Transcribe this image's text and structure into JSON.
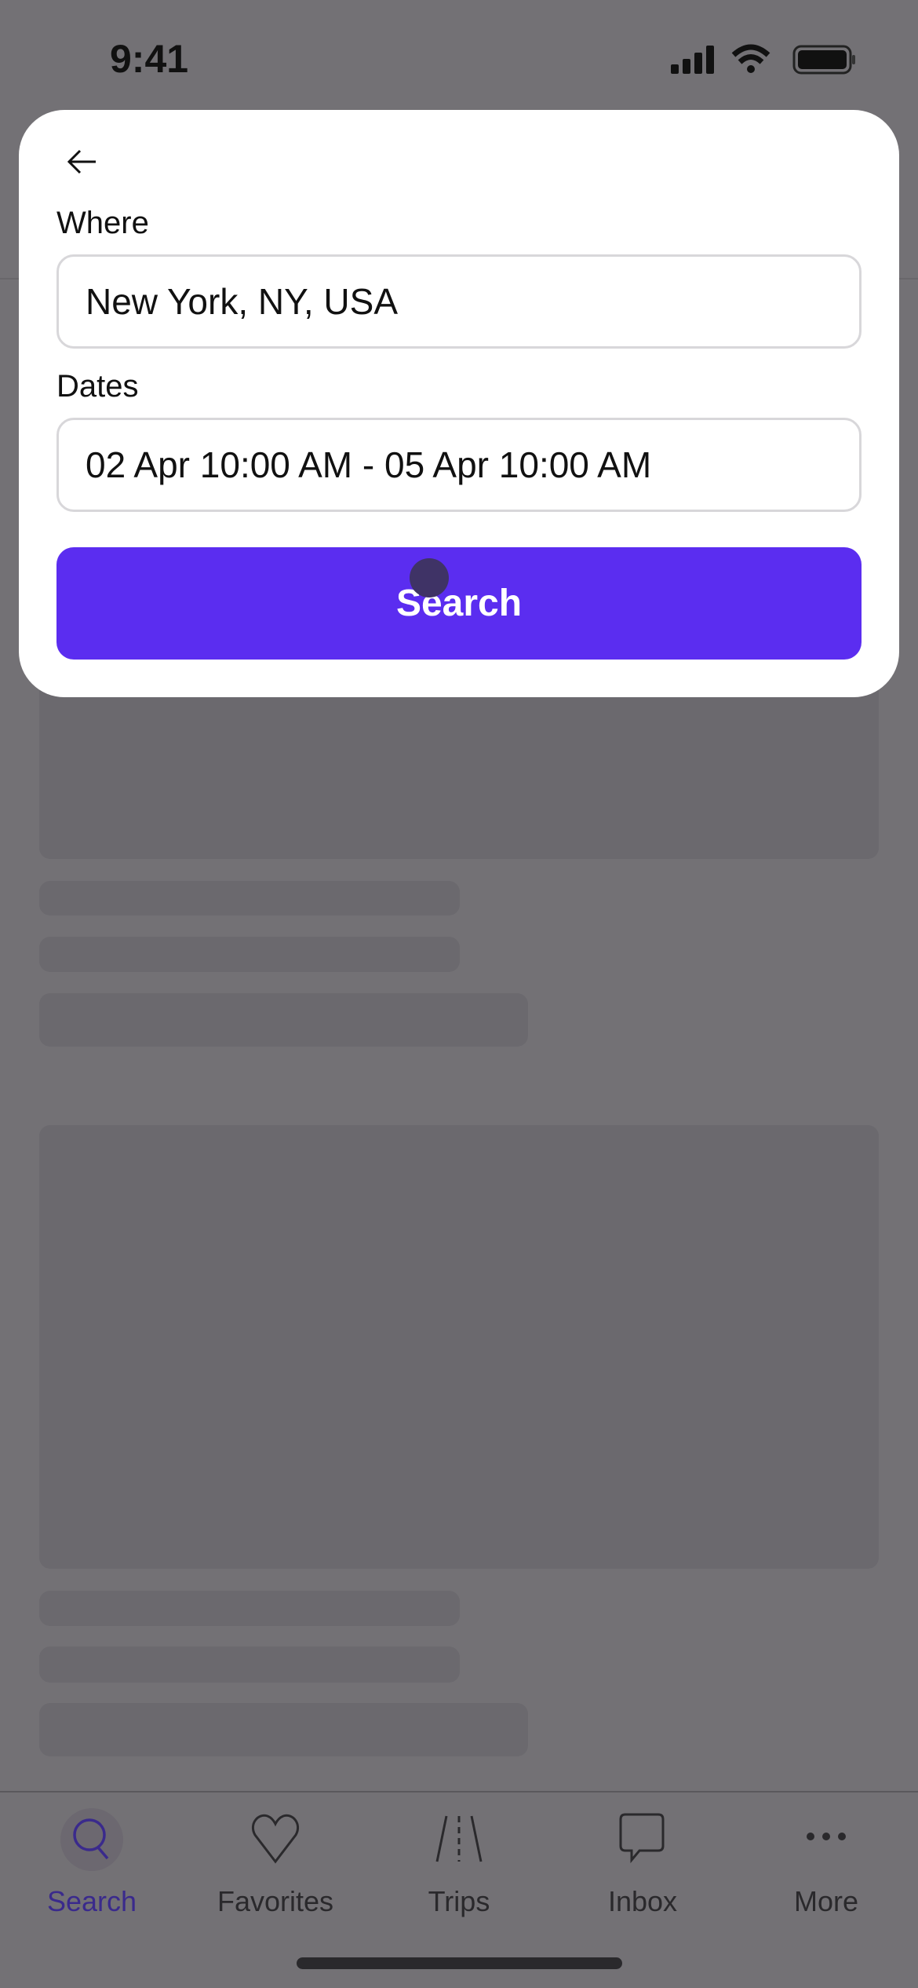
{
  "status_bar": {
    "time": "9:41"
  },
  "search_panel": {
    "where_label": "Where",
    "where_value": "New York, NY, USA",
    "dates_label": "Dates",
    "dates_value": "02 Apr 10:00 AM - 05 Apr 10:00 AM",
    "search_button": "Search"
  },
  "tab_bar": {
    "active": "Search",
    "accent_color": "#3a2a8c",
    "items": [
      {
        "label": "Search",
        "icon": "search-icon"
      },
      {
        "label": "Favorites",
        "icon": "heart-icon"
      },
      {
        "label": "Trips",
        "icon": "road-icon"
      },
      {
        "label": "Inbox",
        "icon": "chat-bubble-icon"
      },
      {
        "label": "More",
        "icon": "more-icon"
      }
    ]
  },
  "colors": {
    "primary": "#5b2df0",
    "overlay": "#737175"
  }
}
